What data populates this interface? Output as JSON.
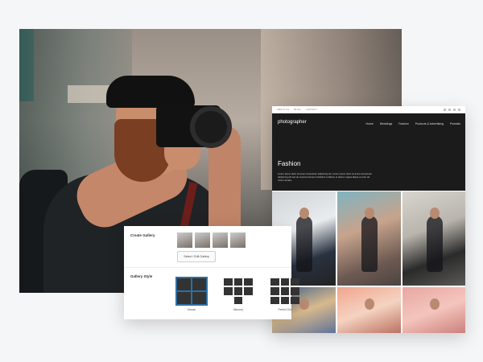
{
  "site": {
    "topbar_links": [
      "ABOUT US",
      "BLOG",
      "CONTACT"
    ],
    "brand": "photographer",
    "nav": [
      "Home",
      "Weddings",
      "Fashion",
      "Products & Advertising",
      "Portraits"
    ],
    "page_title": "Fashion",
    "description": "Lorem ipsum dolor sit amet consectetur adipiscing elit. Lorem ipsum dolor sit amet consectetur adipiscing elit sed do eiusmod tempor incididunt ut labore et dolore magna aliqua ut enim ad minim veniam."
  },
  "panel": {
    "create_gallery_label": "Create Gallery",
    "select_button": "Select / Edit Gallery",
    "gallery_style_label": "Gallery Style",
    "styles": [
      {
        "label": "Mosaic",
        "selected": true
      },
      {
        "label": "Masonry",
        "selected": false
      },
      {
        "label": "Perfect Grid",
        "selected": false
      }
    ]
  },
  "colors": {
    "selected_outline": "#2c6fa3",
    "site_header": "#1b1b1b"
  }
}
